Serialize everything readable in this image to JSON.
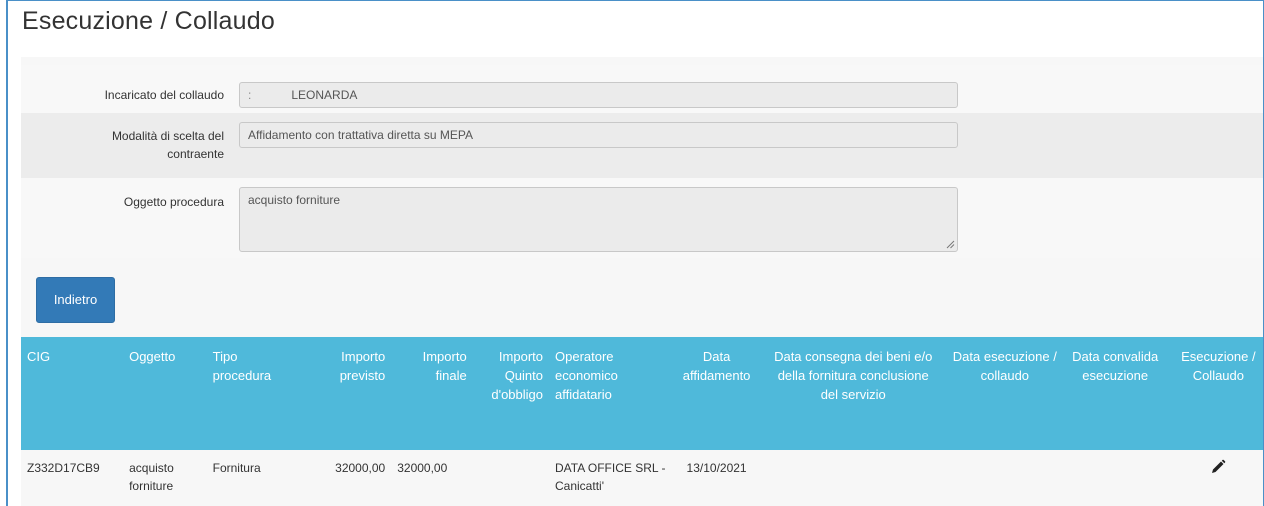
{
  "page": {
    "title": "Esecuzione / Collaudo"
  },
  "form": {
    "tester": {
      "label": "Incaricato del collaudo",
      "prefix": ":",
      "value": "LEONARDA"
    },
    "procedure_choice": {
      "label": "Modalità di scelta del contraente",
      "value": "Affidamento con trattativa diretta su MEPA"
    },
    "procedure_object": {
      "label": "Oggetto procedura",
      "value": "acquisto forniture"
    }
  },
  "actions": {
    "back_label": "Indietro"
  },
  "table": {
    "headers": [
      "CIG",
      "Oggetto",
      "Tipo procedura",
      "Importo previsto",
      "Importo finale",
      "Importo Quinto d'obbligo",
      "Operatore economico affidatario",
      "Data affidamento",
      "Data consegna dei beni e/o della fornitura conclusione del servizio",
      "Data esecuzione / collaudo",
      "Data convalida esecuzione",
      "Esecuzione / Collaudo"
    ],
    "rows": [
      {
        "cig": "Z332D17CB9",
        "oggetto": "acquisto forniture",
        "tipo": "Fornitura",
        "importo_previsto": "32000,00",
        "importo_finale": "32000,00",
        "importo_quinto": "",
        "operatore": "DATA OFFICE SRL - Canicatti'",
        "data_affidamento": "13/10/2021",
        "data_consegna": "",
        "data_esecuzione": "",
        "data_convalida": "",
        "action_icon": "pencil-icon"
      }
    ]
  },
  "colors": {
    "header_bg": "#4fb9da",
    "button_bg": "#337ab7",
    "frame_border": "#4a90c8"
  }
}
